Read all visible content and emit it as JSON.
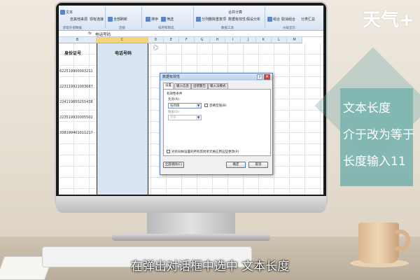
{
  "ribbon": {
    "buttons": [
      "文本",
      "自其他来源",
      "现有连接",
      "全部刷新",
      "排序",
      "筛选",
      "分列",
      "删除重复项",
      "数据有效性",
      "合并计算",
      "假设分析",
      "组合",
      "取消组合",
      "分类汇总"
    ],
    "groups": [
      "获取外部数据",
      "连接",
      "排序和筛选",
      "数据工具",
      "分级显示"
    ]
  },
  "formula_bar": {
    "fx": "fx",
    "value": "电话号码"
  },
  "columns": [
    "B",
    "C",
    "D",
    "E",
    "F",
    "G",
    "H",
    "I",
    "J",
    "K",
    "L",
    "M"
  ],
  "sheet": {
    "header_b": "身份证号",
    "header_c": "电话号码",
    "ids": [
      "622519900003211",
      "223119921003687",
      "224119850255438",
      "223519930005502",
      "338199401011217"
    ]
  },
  "dialog": {
    "title": "数据有效性",
    "help": "?",
    "close": "×",
    "tabs": [
      "设置",
      "输入信息",
      "出错警告",
      "输入法模式"
    ],
    "section_label": "有效性条件",
    "allow_label": "允许(A):",
    "allow_value": "任何值",
    "ignore_blank_label": "忽略空值(B)",
    "data_label": "数据(D):",
    "data_value": "介于",
    "apply_all_label": "对有同样设置的所有其他单元格应用这些更改(P)",
    "clear_all_button": "全部清除(C)",
    "ok_button": "确定",
    "cancel_button": "取消"
  },
  "overlay": {
    "logo": "天气+",
    "caption_lines": [
      "文本长度",
      "介于改为等于",
      "长度输入11"
    ],
    "subtitle": "在弹出对话框中选中 文本长度"
  }
}
